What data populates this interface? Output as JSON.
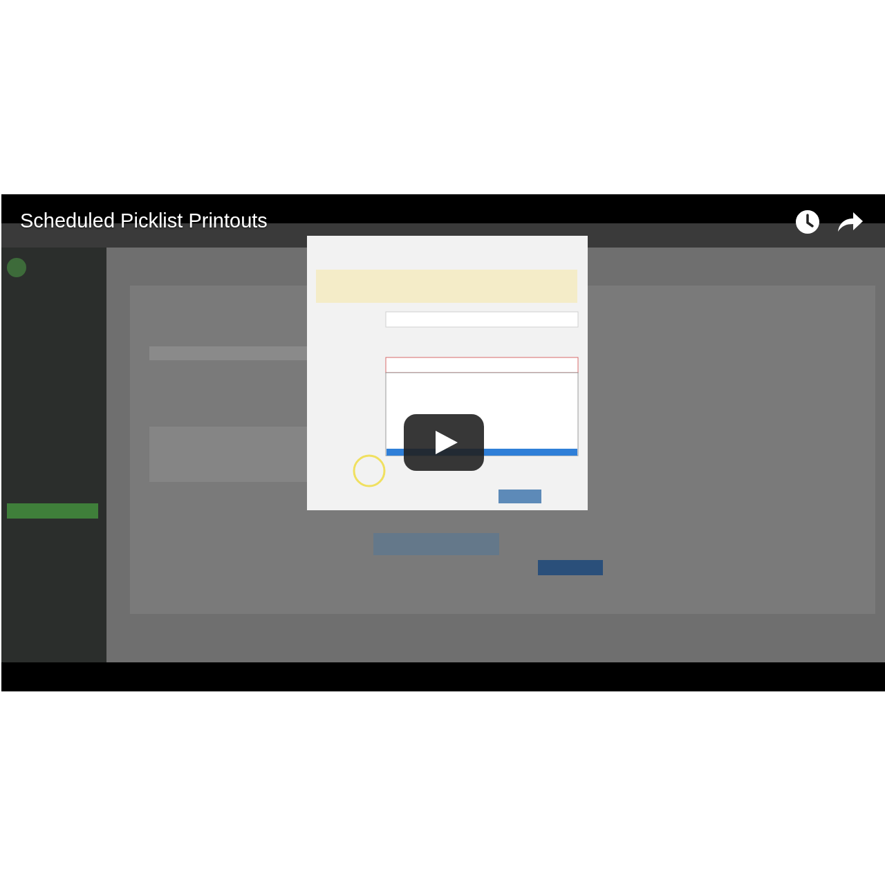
{
  "video": {
    "title": "Scheduled Picklist Printouts"
  }
}
